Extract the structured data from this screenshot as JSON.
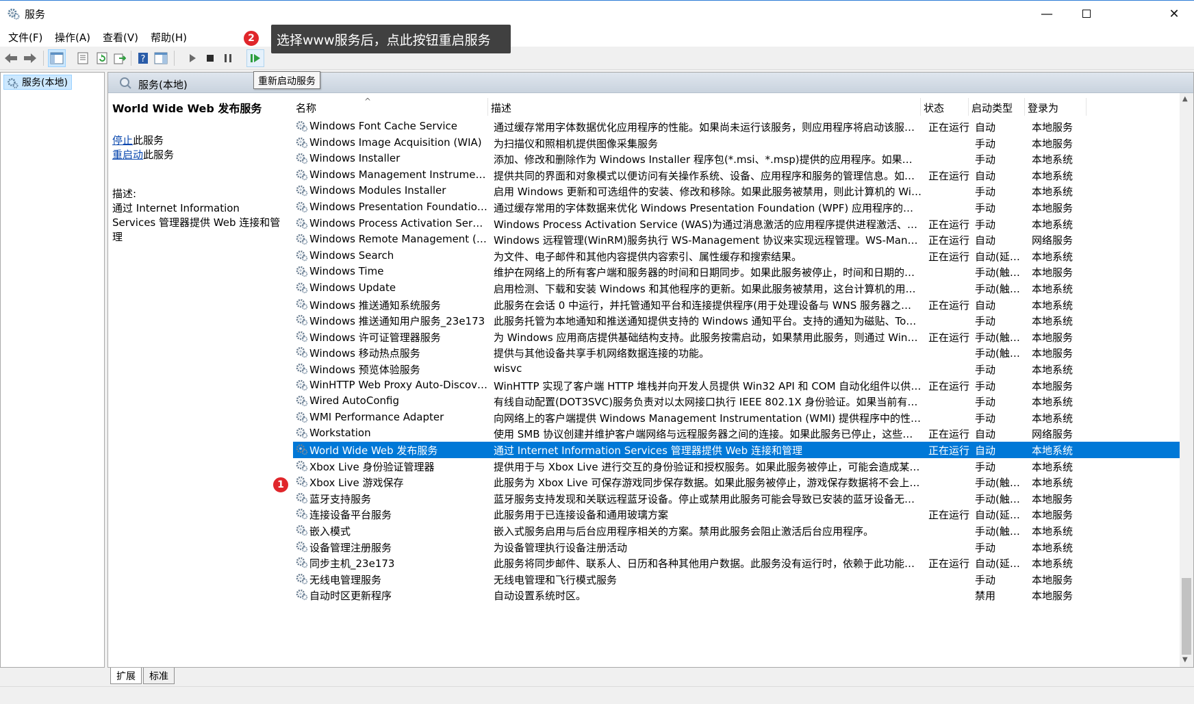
{
  "window": {
    "title": "服务"
  },
  "menu": [
    "文件(F)",
    "操作(A)",
    "查看(V)",
    "帮助(H)"
  ],
  "toolbar": {
    "tooltip": "重新启动服务"
  },
  "annotations": {
    "badge1": "1",
    "badge2": "2",
    "callout": "选择www服务后，点此按钮重启服务"
  },
  "tree": {
    "root": "服务(本地)"
  },
  "pane": {
    "header": "服务(本地)",
    "selected_title": "World Wide Web 发布服务",
    "stop_link": "停止",
    "stop_suffix": "此服务",
    "restart_link": "重启动",
    "restart_suffix": "此服务",
    "desc_label": "描述:",
    "desc_text": "通过 Internet Information Services 管理器提供 Web 连接和管理"
  },
  "columns": [
    "名称",
    "描述",
    "状态",
    "启动类型",
    "登录为"
  ],
  "rows": [
    {
      "name": "Windows Font Cache Service",
      "desc": "通过缓存常用字体数据优化应用程序的性能。如果尚未运行该服务，则应用程序将启动该服务。也可以...",
      "status": "正在运行",
      "start": "自动",
      "logon": "本地服务"
    },
    {
      "name": "Windows Image Acquisition (WIA)",
      "desc": "为扫描仪和照相机提供图像采集服务",
      "status": "",
      "start": "手动",
      "logon": "本地服务"
    },
    {
      "name": "Windows Installer",
      "desc": "添加、修改和删除作为 Windows Installer 程序包(*.msi、*.msp)提供的应用程序。如果禁用此服务，...",
      "status": "",
      "start": "手动",
      "logon": "本地系统"
    },
    {
      "name": "Windows Management Instrumentation",
      "desc": "提供共同的界面和对象模式以便访问有关操作系统、设备、应用程序和服务的管理信息。如果此服务被...",
      "status": "正在运行",
      "start": "自动",
      "logon": "本地系统"
    },
    {
      "name": "Windows Modules Installer",
      "desc": "启用 Windows 更新和可选组件的安装、修改和移除。如果此服务被禁用，则此计算机的 Windows 更...",
      "status": "",
      "start": "手动",
      "logon": "本地系统"
    },
    {
      "name": "Windows Presentation Foundation Fo...",
      "desc": "通过缓存常用的字体数据来优化 Windows Presentation Foundation (WPF) 应用程序的性能。WPF ...",
      "status": "",
      "start": "手动",
      "logon": "本地服务"
    },
    {
      "name": "Windows Process Activation Service",
      "desc": "Windows Process Activation Service (WAS)为通过消息激活的应用程序提供进程激活、资源管理和...",
      "status": "正在运行",
      "start": "手动",
      "logon": "本地系统"
    },
    {
      "name": "Windows Remote Management (WS-...",
      "desc": "Windows 远程管理(WinRM)服务执行 WS-Management 协议来实现远程管理。WS-Management ...",
      "status": "正在运行",
      "start": "自动",
      "logon": "网络服务"
    },
    {
      "name": "Windows Search",
      "desc": "为文件、电子邮件和其他内容提供内容索引、属性缓存和搜索结果。",
      "status": "正在运行",
      "start": "自动(延迟...",
      "logon": "本地系统"
    },
    {
      "name": "Windows Time",
      "desc": "维护在网络上的所有客户端和服务器的时间和日期同步。如果此服务被停止，时间和日期的同步将不可...",
      "status": "",
      "start": "手动(触发...",
      "logon": "本地服务"
    },
    {
      "name": "Windows Update",
      "desc": "启用检测、下载和安装 Windows 和其他程序的更新。如果此服务被禁用，这台计算机的用户将无法使...",
      "status": "",
      "start": "手动(触发...",
      "logon": "本地系统"
    },
    {
      "name": "Windows 推送通知系统服务",
      "desc": "此服务在会话 0 中运行，并托管通知平台和连接提供程序(用于处理设备与 WNS 服务器之间的连接)。",
      "status": "正在运行",
      "start": "自动",
      "logon": "本地系统"
    },
    {
      "name": "Windows 推送通知用户服务_23e173",
      "desc": "此服务托管为本地通知和推送通知提供支持的 Windows 通知平台。支持的通知为磁贴、Toast 和 Ra...",
      "status": "",
      "start": "手动",
      "logon": "本地系统"
    },
    {
      "name": "Windows 许可证管理器服务",
      "desc": "为 Windows 应用商店提供基础结构支持。此服务按需启动，如果禁用此服务，则通过 Windows 应用...",
      "status": "正在运行",
      "start": "手动(触发...",
      "logon": "本地服务"
    },
    {
      "name": "Windows 移动热点服务",
      "desc": "提供与其他设备共享手机网络数据连接的功能。",
      "status": "",
      "start": "手动(触发...",
      "logon": "本地服务"
    },
    {
      "name": "Windows 预览体验服务",
      "desc": "wisvc",
      "status": "",
      "start": "手动",
      "logon": "本地系统"
    },
    {
      "name": "WinHTTP Web Proxy Auto-Discovery ...",
      "desc": "WinHTTP 实现了客户端 HTTP 堆栈并向开发人员提供 Win32 API 和 COM 自动化组件以供发送 HTT...",
      "status": "正在运行",
      "start": "手动",
      "logon": "本地服务"
    },
    {
      "name": "Wired AutoConfig",
      "desc": "有线自动配置(DOT3SVC)服务负责对以太网接口执行 IEEE 802.1X 身份验证。如果当前有线网络部署...",
      "status": "",
      "start": "手动",
      "logon": "本地系统"
    },
    {
      "name": "WMI Performance Adapter",
      "desc": "向网络上的客户端提供 Windows Management Instrumentation (WMI) 提供程序中的性能库信息。...",
      "status": "",
      "start": "手动",
      "logon": "本地系统"
    },
    {
      "name": "Workstation",
      "desc": "使用 SMB 协议创建并维护客户端网络与远程服务器之间的连接。如果此服务已停止，这些连接将无法...",
      "status": "正在运行",
      "start": "自动",
      "logon": "网络服务"
    },
    {
      "name": "World Wide Web 发布服务",
      "desc": "通过 Internet Information Services 管理器提供 Web 连接和管理",
      "status": "正在运行",
      "start": "自动",
      "logon": "本地系统",
      "selected": true
    },
    {
      "name": "Xbox Live 身份验证管理器",
      "desc": "提供用于与 Xbox Live 进行交互的身份验证和授权服务。如果此服务被停止，可能会造成某些应用程序...",
      "status": "",
      "start": "手动",
      "logon": "本地系统"
    },
    {
      "name": "Xbox Live 游戏保存",
      "desc": "此服务为 Xbox Live 可保存游戏同步保存数据。如果此服务被停止，游戏保存数据将不会上传至 Xbox...",
      "status": "",
      "start": "手动(触发...",
      "logon": "本地系统"
    },
    {
      "name": "蓝牙支持服务",
      "desc": "蓝牙服务支持发现和关联远程蓝牙设备。停止或禁用此服务可能会导致已安装的蓝牙设备无法正常运行...",
      "status": "",
      "start": "手动(触发...",
      "logon": "本地服务"
    },
    {
      "name": "连接设备平台服务",
      "desc": "此服务用于已连接设备和通用玻璃方案",
      "status": "正在运行",
      "start": "自动(延迟...",
      "logon": "本地服务"
    },
    {
      "name": "嵌入模式",
      "desc": "嵌入式服务启用与后台应用程序相关的方案。禁用此服务会阻止激活后台应用程序。",
      "status": "",
      "start": "手动(触发...",
      "logon": "本地系统"
    },
    {
      "name": "设备管理注册服务",
      "desc": "为设备管理执行设备注册活动",
      "status": "",
      "start": "手动",
      "logon": "本地系统"
    },
    {
      "name": "同步主机_23e173",
      "desc": "此服务将同步邮件、联系人、日历和各种其他用户数据。此服务没有运行时，依赖于此功能的邮件和其...",
      "status": "正在运行",
      "start": "自动(延迟...",
      "logon": "本地系统"
    },
    {
      "name": "无线电管理服务",
      "desc": "无线电管理和飞行模式服务",
      "status": "",
      "start": "手动",
      "logon": "本地服务"
    },
    {
      "name": "自动时区更新程序",
      "desc": "自动设置系统时区。",
      "status": "",
      "start": "禁用",
      "logon": "本地服务"
    }
  ],
  "tabs": [
    "扩展",
    "标准"
  ],
  "colors": {
    "selection": "#0078d7",
    "badge": "#e0262b",
    "callout": "#404040"
  }
}
